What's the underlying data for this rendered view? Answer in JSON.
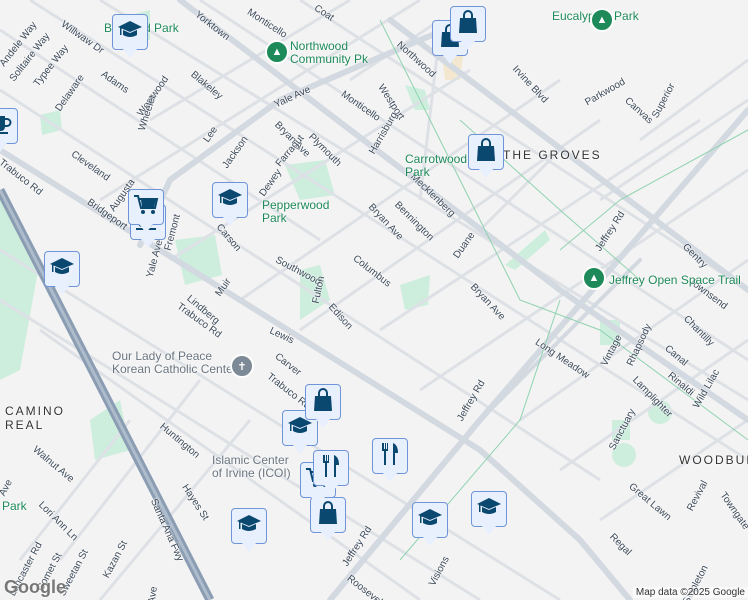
{
  "streets": [
    "Willwaw Dr",
    "Yorktown",
    "Monticello",
    "Coat",
    "Andele Way",
    "Solitaire Way",
    "Typee Way",
    "Delaware",
    "Adams",
    "Westwood",
    "Wheeler",
    "Blakeley",
    "Lee",
    "Yale Ave",
    "Monticello",
    "Westport",
    "Northwood",
    "Plymouth",
    "Harrisburg",
    "Bryan Ave",
    "Farragut",
    "Cleveland",
    "Jackson",
    "Dewey",
    "Augusta",
    "Bridgeport",
    "Fremont",
    "Carson",
    "Southwood",
    "Columbus",
    "Fulton",
    "Edison",
    "Muir",
    "Lindberg",
    "Lewis",
    "Carver",
    "Trabuco Rd",
    "Trabuco Rd",
    "Trabuco Rd",
    "Yale Ave",
    "Bryan Ave",
    "Bryan Ave",
    "Mecklenberg",
    "Bennington",
    "Duane",
    "Irvine Blvd",
    "Parkwood",
    "Canvas",
    "Superior",
    "Jeffrey Rd",
    "Jeffrey Rd",
    "Jeffrey Rd",
    "Gentry",
    "Townsend",
    "Chantilly",
    "Vintage",
    "Rhapsody",
    "Canal",
    "Rinaldi",
    "Wild Lilac",
    "Lamplighter",
    "Long Meadow",
    "Sanctuary",
    "Great Lawn",
    "Revival",
    "Towngate",
    "Regal",
    "Stapleton",
    "Visions",
    "Roosevelt",
    "Huntington",
    "Hayes St",
    "Walnut Ave",
    "Lori Ann Ln",
    "Kazan St",
    "Sweetan St",
    "Comet St",
    "Lancaster Rd",
    "Santa Ana Fwy",
    "Ave",
    "Ave"
  ],
  "parks": [
    "Brywood Park",
    "Northwood\nCommunity Pk",
    "Eucalyptus Park",
    "Pepperwood\nPark",
    "Carrotwood\nPark",
    "Jeffrey Open Space Trail",
    "Park"
  ],
  "neighborhoods": [
    "THE GROVES",
    "CAMINO\nREAL",
    "WOODBURY"
  ],
  "places": [
    "Our Lady of Peace\nKorean Catholic Center",
    "Islamic Center\nof Irvine (ICOI)"
  ],
  "markers": [
    "school",
    "school",
    "school",
    "school",
    "school",
    "school",
    "school",
    "shopping",
    "shopping",
    "shopping",
    "shopping",
    "shopping",
    "cafe",
    "grocery",
    "grocery",
    "restaurant",
    "restaurant",
    "cafe"
  ],
  "footer": {
    "attribution": "Map data ©2025 Google",
    "logo": "Google"
  },
  "colors": {
    "marker_icon": "#0b4870",
    "park": "#1e8a5a",
    "background": "#f4f3f3"
  }
}
